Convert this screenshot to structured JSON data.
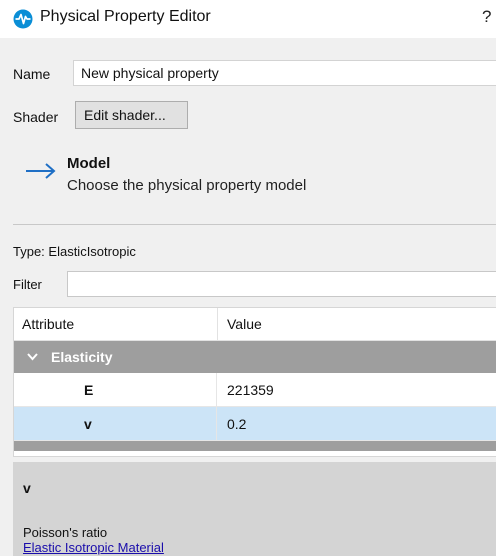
{
  "window": {
    "title": "Physical Property Editor",
    "help_label": "?",
    "icon": "waveform-icon",
    "icon_color": "#0a8ed6"
  },
  "form": {
    "name_label": "Name",
    "name_value": "New physical property",
    "shader_label": "Shader",
    "shader_button": "Edit shader..."
  },
  "step": {
    "icon": "arrow-right-icon",
    "title": "Model",
    "subtitle": "Choose the physical property model"
  },
  "type": {
    "label": "Type: ElasticIsotropic"
  },
  "filter": {
    "label": "Filter",
    "value": ""
  },
  "grid": {
    "headers": [
      "Attribute",
      "Value"
    ],
    "group": {
      "label": "Elasticity",
      "icon": "chevron-down-icon"
    },
    "rows": [
      {
        "attribute": "E",
        "value": "221359",
        "selected": false
      },
      {
        "attribute": "v",
        "value": "0.2",
        "selected": true
      }
    ]
  },
  "description": {
    "title": "v",
    "text": "Poisson's ratio",
    "link": "Elastic Isotropic Material"
  },
  "colors": {
    "selection": "#cce4f7",
    "group_header": "#9e9e9e",
    "link": "#1a0dab",
    "accent_arrow": "#1f6fc5"
  }
}
